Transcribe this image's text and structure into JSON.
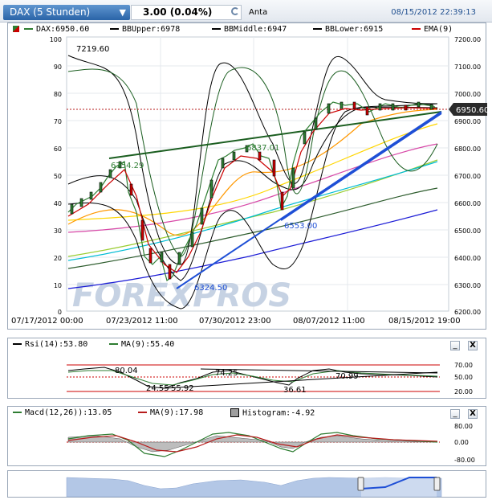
{
  "header": {
    "symbol_label": "DAX (5 Stunden)",
    "price_change": "3.00 (0.04%)",
    "market_label": "Anta",
    "timestamp": "08/15/2012 22:39:13"
  },
  "main_chart": {
    "legend": [
      {
        "label": "DAX:6950.60",
        "color": "#2e7d32"
      },
      {
        "label": "BBUpper:6978",
        "color": "#000000"
      },
      {
        "label": "BBMiddle:6947",
        "color": "#000000"
      },
      {
        "label": "BBLower:6915",
        "color": "#000000"
      },
      {
        "label": "EMA(9)",
        "color": "#cc0000"
      }
    ],
    "left_axis_ticks": [
      "100",
      "90",
      "80",
      "70",
      "60",
      "50",
      "40",
      "30",
      "20",
      "10",
      "0"
    ],
    "right_axis_ticks": [
      "7200.00",
      "7100.00",
      "7000.00",
      "6900.00",
      "6800.00",
      "6700.00",
      "6600.00",
      "6500.00",
      "6400.00",
      "6300.00",
      "6200.00"
    ],
    "x_axis_labels": [
      "07/17/2012 00:00",
      "07/23/2012 11:00",
      "07/30/2012 23:00",
      "08/07/2012 11:00",
      "08/15/2012 19:00"
    ],
    "annotations": [
      "7219.60",
      "6754.29",
      "6837.01",
      "6553.00",
      "6324.50"
    ],
    "last_price": "6950.60",
    "watermark": "FOREXPROS"
  },
  "rsi_panel": {
    "legend": [
      {
        "label": "Rsi(14):53.80",
        "color": "#000000"
      },
      {
        "label": "MA(9):55.40",
        "color": "#2e7d32"
      }
    ],
    "right_ticks": [
      "70.00",
      "50.00",
      "20.00"
    ],
    "annotations": [
      "80.04",
      "74.25",
      "70.99",
      "24.55",
      "55.92",
      "36.61"
    ]
  },
  "macd_panel": {
    "legend": [
      {
        "label": "Macd(12,26)):13.05",
        "color": "#2e7d32"
      },
      {
        "label": "MA(9):17.98",
        "color": "#b71c1c"
      },
      {
        "label": "Histogram:-4.92",
        "color": "#9e9e9e"
      }
    ],
    "right_ticks": [
      "80.00",
      "0.00",
      "-80.00"
    ]
  },
  "controls": {
    "minimize": "_",
    "close": "X"
  }
}
